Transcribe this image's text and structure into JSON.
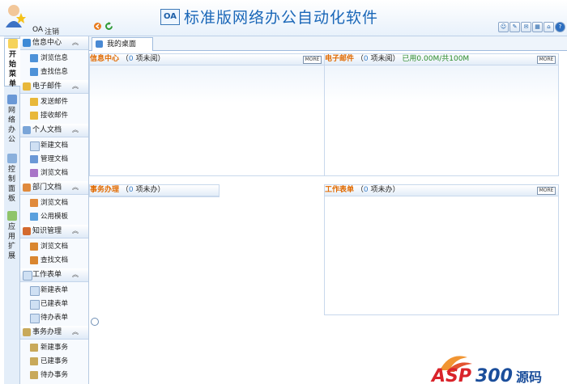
{
  "header": {
    "app_title": "标准版网络办公自动化软件",
    "logo_text": "OA",
    "user_name": "OA",
    "logout_label": "注销",
    "toolbar_icons": [
      "chat-icon",
      "edit-icon",
      "mail-icon",
      "calendar-icon",
      "home-icon",
      "help-icon"
    ]
  },
  "vtabs": [
    {
      "label": "开\n始\n菜\n单",
      "icon": "bulb-icon"
    },
    {
      "label": "网\n络\n办\n公",
      "icon": "office-icon"
    },
    {
      "label": "控\n制\n面\n板",
      "icon": "control-icon"
    },
    {
      "label": "应\n用\n扩\n展",
      "icon": "star-icon"
    }
  ],
  "menu": {
    "groups": [
      {
        "label": "信息中心",
        "items": [
          "浏览信息",
          "查找信息"
        ]
      },
      {
        "label": "电子邮件",
        "items": [
          "发送邮件",
          "接收邮件"
        ]
      },
      {
        "label": "个人文档",
        "items": [
          "新建文档",
          "管理文档",
          "浏览文档"
        ]
      },
      {
        "label": "部门文档",
        "items": [
          "浏览文档",
          "公用模板"
        ]
      },
      {
        "label": "知识管理",
        "items": [
          "浏览文档",
          "查找文档"
        ]
      },
      {
        "label": "工作表单",
        "items": [
          "新建表单",
          "已建表单",
          "待办表单"
        ]
      },
      {
        "label": "事务办理",
        "items": [
          "新建事务",
          "已建事务",
          "待办事务"
        ]
      }
    ]
  },
  "main": {
    "tab_label": "我的桌面",
    "more_label": "MORE",
    "panels": {
      "info": {
        "title": "信息中心",
        "open": "（",
        "count": "0",
        "suffix": "项未阅）",
        "extra": ""
      },
      "mail": {
        "title": "电子邮件",
        "open": "（",
        "count": "0",
        "suffix": "项未阅）",
        "extra": "已用0.00M/共100M"
      },
      "affairs": {
        "title": "事务办理",
        "open": "（",
        "count": "0",
        "suffix": "项未办）",
        "extra": ""
      },
      "forms": {
        "title": "工作表单",
        "open": "（",
        "count": "0",
        "suffix": "项未办）",
        "extra": ""
      }
    }
  },
  "watermark": {
    "brand": "ASP300",
    "suffix": "源码"
  }
}
